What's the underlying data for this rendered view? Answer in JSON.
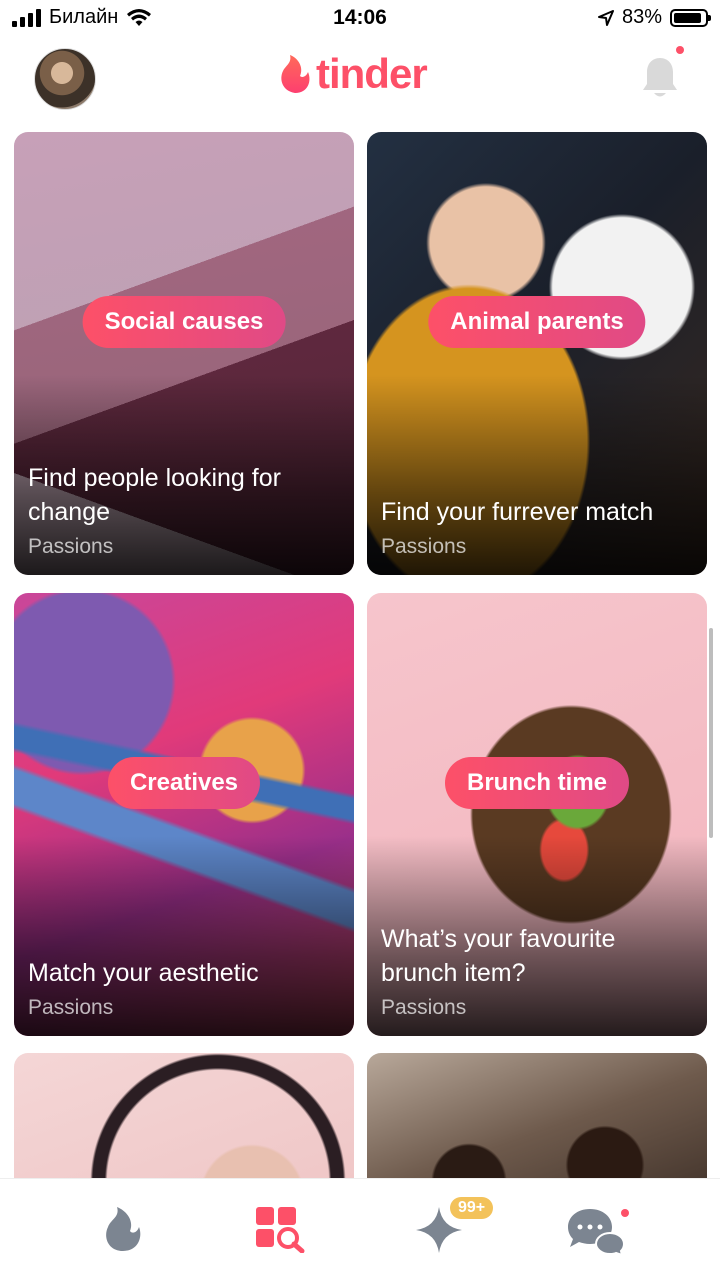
{
  "status_bar": {
    "carrier": "Билайн",
    "time": "14:06",
    "battery": "83%"
  },
  "header": {
    "logo_text": "tinder"
  },
  "cards": [
    {
      "tag": "Social causes",
      "caption": "Find people looking for change",
      "category": "Passions"
    },
    {
      "tag": "Animal parents",
      "caption": "Find your furrever match",
      "category": "Passions"
    },
    {
      "tag": "Creatives",
      "caption": "Match your aesthetic",
      "category": "Passions"
    },
    {
      "tag": "Brunch time",
      "caption": "What’s your favourite brunch item?",
      "category": "Passions"
    }
  ],
  "nav": {
    "badge": "99+"
  },
  "colors": {
    "brand": "#fd5068",
    "gold": "#f3c25a"
  }
}
